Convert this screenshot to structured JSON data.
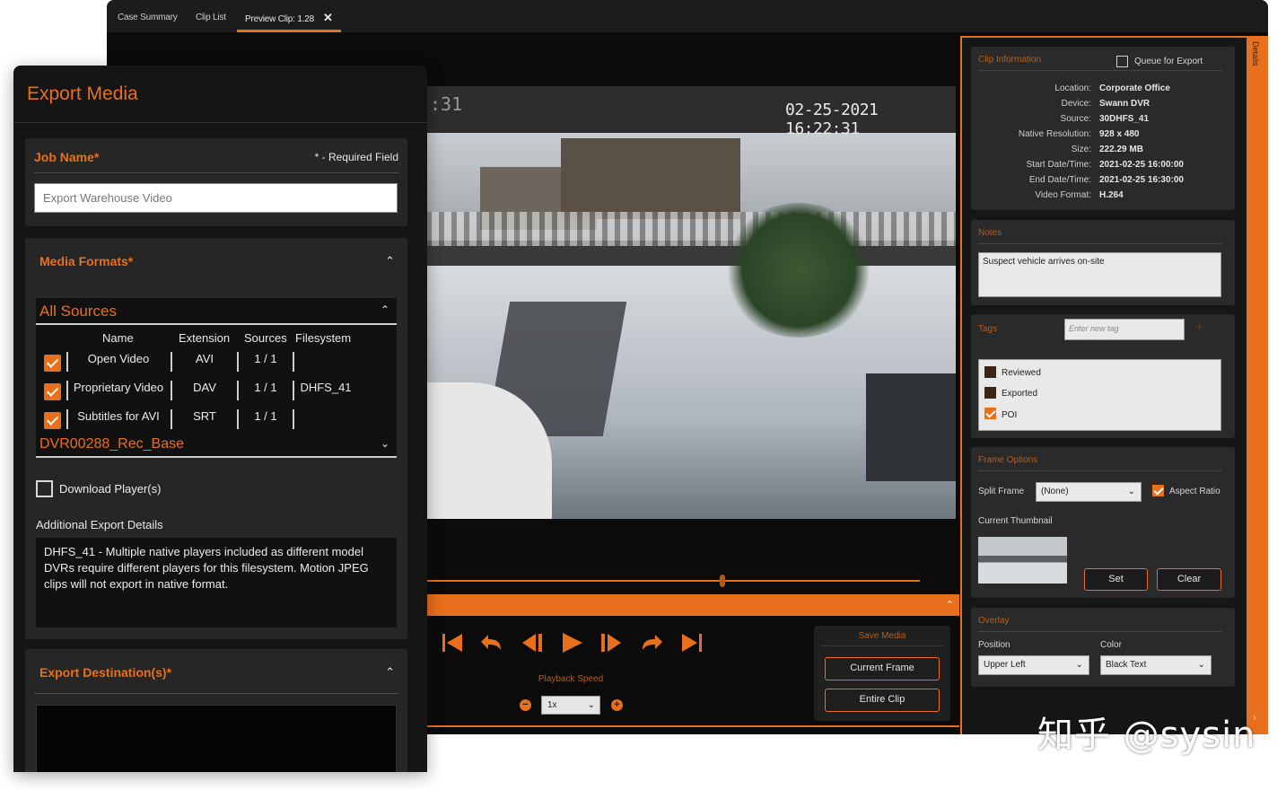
{
  "player_window": {
    "tabs": [
      {
        "label": "Case Summary"
      },
      {
        "label": "Clip List"
      },
      {
        "label": "Preview Clip: 1.28",
        "active": true
      }
    ],
    "tab_close_glyph": "✕",
    "video": {
      "timestamp": "02-25-2021 16:22:31",
      "partial_time": ":31"
    },
    "seek": {
      "position_fraction": 0.6
    },
    "transport_icons": [
      "skip-start-icon",
      "rewind-icon",
      "step-back-icon",
      "play-icon",
      "step-forward-icon",
      "fast-forward-icon",
      "skip-end-icon"
    ],
    "playback_speed": {
      "label": "Playback Speed",
      "value": "1x",
      "minus": "−",
      "plus": "+"
    },
    "save_media": {
      "title": "Save Media",
      "current_frame": "Current Frame",
      "entire_clip": "Entire Clip"
    },
    "clip_information": {
      "title": "Clip Information",
      "queue_label": "Queue for Export",
      "rows": [
        {
          "key": "Location:",
          "value": "Corporate Office"
        },
        {
          "key": "Device:",
          "value": "Swann DVR"
        },
        {
          "key": "Source:",
          "value": "30DHFS_41"
        },
        {
          "key": "Native Resolution:",
          "value": "928 x 480"
        },
        {
          "key": "Size:",
          "value": "222.29 MB"
        },
        {
          "key": "Start Date/Time:",
          "value": "2021-02-25 16:00:00"
        },
        {
          "key": "End Date/Time:",
          "value": "2021-02-25 16:30:00"
        },
        {
          "key": "Video Format:",
          "value": "H.264"
        }
      ]
    },
    "notes": {
      "title": "Notes",
      "value": "Suspect vehicle arrives on-site"
    },
    "tags": {
      "title": "Tags",
      "placeholder": "Enter new tag",
      "add_glyph": "+",
      "items": [
        {
          "label": "Reviewed",
          "checked": false
        },
        {
          "label": "Exported",
          "checked": false
        },
        {
          "label": "POI",
          "checked": true
        }
      ]
    },
    "frame_options": {
      "title": "Frame Options",
      "split_frame_label": "Split Frame",
      "split_frame_value": "(None)",
      "aspect_ratio_label": "Aspect Ratio",
      "current_thumbnail_label": "Current Thumbnail",
      "set_label": "Set",
      "clear_label": "Clear"
    },
    "overlay": {
      "title": "Overlay",
      "position_label": "Position",
      "position_value": "Upper Left",
      "color_label": "Color",
      "color_value": "Black Text"
    },
    "details_label": "Details",
    "sidebar_arrow": "›"
  },
  "export_window": {
    "title": "Export Media",
    "job_name": {
      "label": "Job Name*",
      "required_note": "* - Required Field",
      "value": "Export Warehouse Video"
    },
    "media_formats": {
      "title": "Media Formats*",
      "caret": "⌃",
      "all_sources_title": "All Sources",
      "columns": [
        "Name",
        "Extension",
        "Sources",
        "Filesystem"
      ],
      "rows": [
        {
          "name": "Open Video",
          "extension": "AVI",
          "sources": "1 / 1",
          "filesystem": "",
          "checked": true
        },
        {
          "name": "Proprietary Video",
          "extension": "DAV",
          "sources": "1 / 1",
          "filesystem": "DHFS_41",
          "checked": true
        },
        {
          "name": "Subtitles for AVI",
          "extension": "SRT",
          "sources": "1 / 1",
          "filesystem": "",
          "checked": true
        }
      ],
      "dvr_title": "DVR00288_Rec_Base",
      "download_players_label": "Download Player(s)",
      "additional_label": "Additional Export Details",
      "additional_text": "DHFS_41 - Multiple native players included as different model DVRs require different players for this filesystem.  Motion JPEG clips will not export in native format."
    },
    "export_destinations": {
      "title": "Export Destination(s)*"
    }
  },
  "watermark": "知乎 @sysin",
  "colors": {
    "accent": "#e8701c",
    "background": "#151515",
    "panel": "#262626"
  }
}
